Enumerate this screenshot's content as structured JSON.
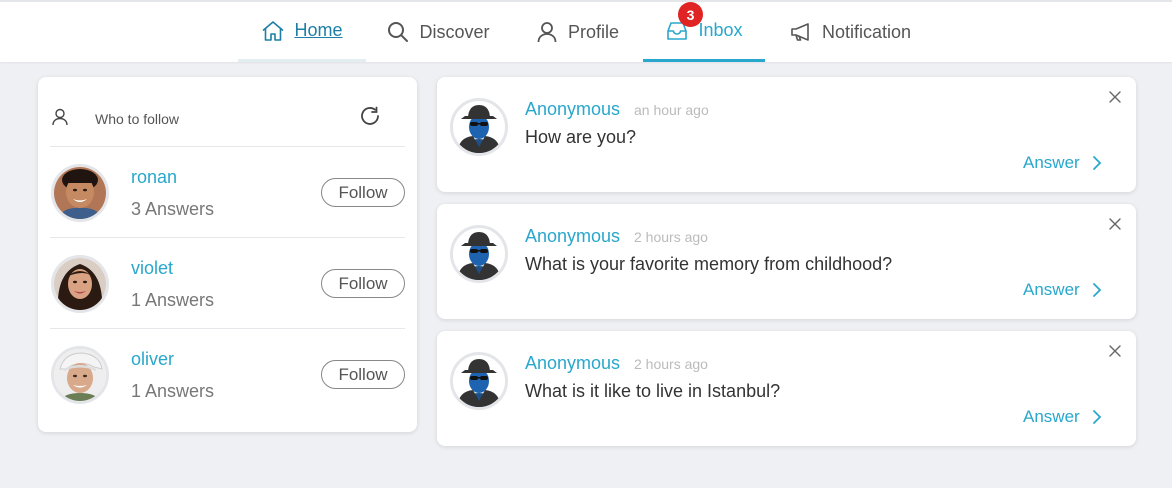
{
  "nav": {
    "items": [
      {
        "label": "Home",
        "icon": "home-icon"
      },
      {
        "label": "Discover",
        "icon": "search-icon"
      },
      {
        "label": "Profile",
        "icon": "user-icon"
      },
      {
        "label": "Inbox",
        "icon": "inbox-icon"
      },
      {
        "label": "Notification",
        "icon": "megaphone-icon"
      }
    ],
    "active": "Inbox",
    "inbox_badge": "3"
  },
  "who_to_follow": {
    "title": "Who to follow",
    "users": [
      {
        "name": "ronan",
        "answers": "3 Answers",
        "follow_label": "Follow"
      },
      {
        "name": "violet",
        "answers": "1 Answers",
        "follow_label": "Follow"
      },
      {
        "name": "oliver",
        "answers": "1 Answers",
        "follow_label": "Follow"
      }
    ]
  },
  "questions": [
    {
      "author": "Anonymous",
      "time": "an hour ago",
      "text": "How are you?",
      "answer_label": "Answer"
    },
    {
      "author": "Anonymous",
      "time": "2 hours ago",
      "text": "What is your favorite memory from childhood?",
      "answer_label": "Answer"
    },
    {
      "author": "Anonymous",
      "time": "2 hours ago",
      "text": "What is it like to live in Istanbul?",
      "answer_label": "Answer"
    }
  ],
  "colors": {
    "accent": "#29a7cc",
    "home": "#1d7fa6",
    "badge": "#e02424",
    "background": "#eff0f4"
  }
}
